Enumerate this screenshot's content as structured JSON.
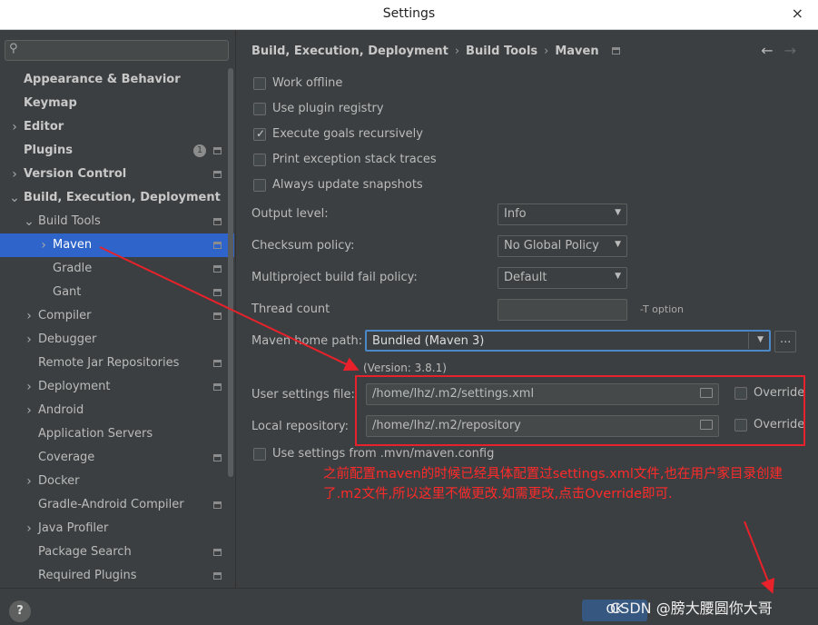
{
  "window": {
    "title": "Settings",
    "close_label": "×"
  },
  "search": {
    "placeholder": "",
    "icon": "search-icon"
  },
  "sidebar": {
    "items": [
      {
        "label": "Appearance & Behavior",
        "bold": true
      },
      {
        "label": "Keymap",
        "bold": true
      },
      {
        "label": "Editor",
        "bold": true
      },
      {
        "label": "Plugins",
        "bold": true,
        "badge": "1"
      },
      {
        "label": "Version Control",
        "bold": true
      },
      {
        "label": "Build, Execution, Deployment",
        "bold": true
      },
      {
        "label": "Build Tools"
      },
      {
        "label": "Maven",
        "selected": true
      },
      {
        "label": "Gradle"
      },
      {
        "label": "Gant"
      },
      {
        "label": "Compiler"
      },
      {
        "label": "Debugger"
      },
      {
        "label": "Remote Jar Repositories"
      },
      {
        "label": "Deployment"
      },
      {
        "label": "Android"
      },
      {
        "label": "Application Servers"
      },
      {
        "label": "Coverage"
      },
      {
        "label": "Docker"
      },
      {
        "label": "Gradle-Android Compiler"
      },
      {
        "label": "Java Profiler"
      },
      {
        "label": "Package Search"
      },
      {
        "label": "Required Plugins"
      }
    ]
  },
  "breadcrumb": {
    "part1": "Build, Execution, Deployment",
    "part2": "Build Tools",
    "part3": "Maven",
    "separator": "›"
  },
  "nav": {
    "back": "←",
    "forward": "→"
  },
  "options": {
    "work_offline": {
      "label": "Work offline",
      "checked": false
    },
    "use_plugin_registry": {
      "label": "Use plugin registry",
      "checked": false
    },
    "execute_goals_recursively": {
      "label": "Execute goals recursively",
      "checked": true
    },
    "print_exception_stack_traces": {
      "label": "Print exception stack traces",
      "checked": false
    },
    "always_update_snapshots": {
      "label": "Always update snapshots",
      "checked": false
    },
    "use_mvn_config": {
      "label": "Use settings from .mvn/maven.config",
      "checked": false
    }
  },
  "fields": {
    "output_level": {
      "label": "Output level:",
      "value": "Info"
    },
    "checksum_policy": {
      "label": "Checksum policy:",
      "value": "No Global Policy"
    },
    "fail_policy": {
      "label": "Multiproject build fail policy:",
      "value": "Default"
    },
    "thread_count": {
      "label": "Thread count",
      "value": "",
      "hint": "-T option"
    },
    "maven_home": {
      "label": "Maven home path:",
      "value": "Bundled (Maven 3)",
      "browse": "...",
      "version": "(Version: 3.8.1)"
    },
    "user_settings": {
      "label": "User settings file:",
      "value": "/home/lhz/.m2/settings.xml",
      "override": "Override"
    },
    "local_repo": {
      "label": "Local repository:",
      "value": "/home/lhz/.m2/repository",
      "override": "Override"
    }
  },
  "annotation": {
    "text": "之前配置maven的时候已经具体配置过settings.xml文件,也在用户家目录创建了.m2文件,所以这里不做更改.如需更改,点击Override即可.",
    "color": "#ff2a2a"
  },
  "footer": {
    "help": "?",
    "ok": "OK",
    "watermark": "CSDN @膀大腰圆你大哥"
  },
  "colors": {
    "selection": "#2f65ca",
    "background": "#3c3f41",
    "annotation": "#e9212a"
  }
}
